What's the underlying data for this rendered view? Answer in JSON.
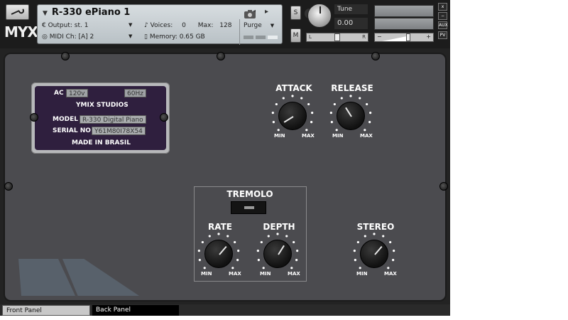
{
  "header": {
    "logo": "MYX",
    "instrument_name": "R-330 ePiano 1",
    "output_label": "Output:",
    "output_value": "st. 1",
    "voices_label": "Voices:",
    "voices_value": "0",
    "max_label": "Max:",
    "max_value": "128",
    "purge_label": "Purge",
    "midi_label": "MIDI Ch:",
    "midi_value": "[A]  2",
    "memory_label": "Memory:",
    "memory_value": "0.65 GB",
    "solo_label": "S",
    "mute_label": "M",
    "tune_label": "Tune",
    "tune_value": "0.00",
    "pan_left": "L",
    "pan_right": "R",
    "vol_minus": "−",
    "vol_plus": "+",
    "close_btn": "x",
    "min_btn": "−",
    "aux_btn": "AUX",
    "pv_btn": "PV"
  },
  "plate": {
    "ac_label": "AC",
    "voltage": "120v",
    "frequency": "60Hz",
    "studio": "YMIX STUDIOS",
    "model_label": "MODEL",
    "model_value": "R-330 Digital Piano",
    "serial_label": "SERIAL NO",
    "serial_value": "Y61M80I78X54",
    "made_in": "MADE IN BRASIL"
  },
  "controls": {
    "attack": {
      "label": "ATTACK",
      "min": "MIN",
      "max": "MAX",
      "level": 0.05
    },
    "release": {
      "label": "RELEASE",
      "min": "MIN",
      "max": "MAX",
      "level": 0.38
    },
    "tremolo_label": "TREMOLO",
    "rate": {
      "label": "RATE",
      "min": "MIN",
      "max": "MAX",
      "level": 0.65
    },
    "depth": {
      "label": "DEPTH",
      "min": "MIN",
      "max": "MAX",
      "level": 0.62
    },
    "stereo": {
      "label": "STEREO",
      "min": "MIN",
      "max": "MAX",
      "level": 0.65
    }
  },
  "tabs": {
    "front": "Front Panel",
    "back": "Back Panel"
  }
}
